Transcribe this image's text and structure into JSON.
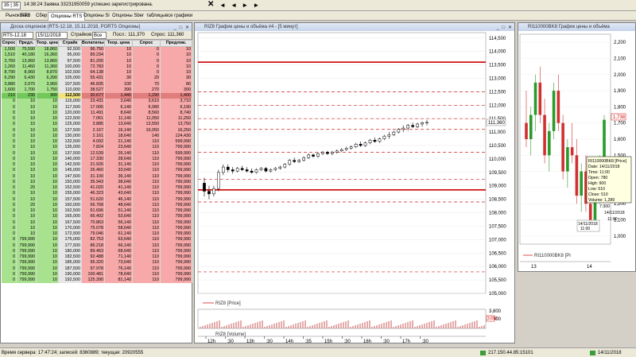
{
  "topbar": {
    "counter": "35 | 35",
    "message": "14:38:24  Заявка 33231950059 успешно зарегистрирована.",
    "nav": "◄ ◄ ► ►"
  },
  "tabs": [
    "Рынок RTS",
    "Бакс",
    "Сбер",
    "Опционы RTS",
    "Опционы Si",
    "Опционы Sber",
    "таблицы",
    "все графики"
  ],
  "options": {
    "title": "Доска опционов (RTS-12.18, 15.11.2018, PORTS Опционы)",
    "base_asset": "RTS-12.18",
    "expiry": "15/11/2018",
    "strikes_label": "Страйков",
    "strikes_value": "Все",
    "last_label": "Посл.: 111,370",
    "bid_label": "Спрос: 111,360",
    "columns": [
      "Спрос",
      "Предл.",
      "Теор. цена",
      "Страйк",
      "Волатильн.",
      "Теор. цена",
      "Спрос",
      "Предлож."
    ],
    "rows": [
      [
        "1,500",
        "75,590",
        "18,860",
        "92,500",
        "96.750",
        "10",
        "0",
        "10"
      ],
      [
        "1,510",
        "40,180",
        "16,360",
        "95,000",
        "89.234",
        "10",
        "0",
        "10"
      ],
      [
        "3,760",
        "13,960",
        "13,860",
        "97,500",
        "81.200",
        "10",
        "0",
        "10"
      ],
      [
        "1,260",
        "11,460",
        "11,360",
        "100,000",
        "72.783",
        "10",
        "0",
        "10"
      ],
      [
        "8,790",
        "8,960",
        "8,870",
        "102,500",
        "64.138",
        "10",
        "0",
        "10"
      ],
      [
        "6,290",
        "6,430",
        "6,390",
        "105,000",
        "55.431",
        "30",
        "20",
        "30"
      ],
      [
        "3,880",
        "3,970",
        "3,960",
        "107,500",
        "46.835",
        "100",
        "70",
        "80"
      ],
      [
        "1,600",
        "1,700",
        "1,750",
        "110,000",
        "38.527",
        "390",
        "270",
        "300"
      ],
      [
        "210",
        "230",
        "300",
        "112,500",
        "30.677",
        "1,440",
        "1,290",
        "1,400"
      ],
      [
        "0",
        "10",
        "10",
        "115,000",
        "23.431",
        "3,640",
        "3,610",
        "3,710"
      ],
      [
        "0",
        "10",
        "10",
        "117,500",
        "17.005",
        "6,140",
        "6,080",
        "6,190"
      ],
      [
        "0",
        "10",
        "10",
        "120,000",
        "11.491",
        "8,640",
        "8,560",
        "8,740"
      ],
      [
        "0",
        "10",
        "10",
        "122,500",
        "7.061",
        "11,140",
        "11,050",
        "11,250"
      ],
      [
        "0",
        "10",
        "10",
        "125,000",
        "3.885",
        "13,640",
        "13,550",
        "13,750"
      ],
      [
        "0",
        "10",
        "10",
        "127,500",
        "2.167",
        "16,140",
        "16,050",
        "16,250"
      ],
      [
        "0",
        "10",
        "10",
        "130,000",
        "2.161",
        "18,640",
        "140",
        "124,430"
      ],
      [
        "0",
        "10",
        "10",
        "132,500",
        "4.092",
        "21,140",
        "110",
        "599,990"
      ],
      [
        "0",
        "10",
        "10",
        "135,000",
        "7.824",
        "23,640",
        "110",
        "799,990"
      ],
      [
        "0",
        "10",
        "10",
        "137,500",
        "12.539",
        "26,140",
        "110",
        "599,990"
      ],
      [
        "0",
        "10",
        "10",
        "140,000",
        "17.330",
        "28,640",
        "110",
        "799,990"
      ],
      [
        "0",
        "10",
        "10",
        "142,500",
        "21.926",
        "31,140",
        "110",
        "799,990"
      ],
      [
        "0",
        "10",
        "10",
        "145,000",
        "26.460",
        "33,640",
        "110",
        "799,990"
      ],
      [
        "0",
        "10",
        "10",
        "147,500",
        "31.100",
        "36,140",
        "110",
        "799,990"
      ],
      [
        "0",
        "10",
        "10",
        "150,000",
        "35.943",
        "38,640",
        "110",
        "799,990"
      ],
      [
        "0",
        "20",
        "10",
        "152,500",
        "41.020",
        "41,140",
        "110",
        "799,990"
      ],
      [
        "0",
        "10",
        "10",
        "155,000",
        "46.323",
        "43,640",
        "110",
        "799,990"
      ],
      [
        "0",
        "10",
        "10",
        "157,500",
        "51.620",
        "46,140",
        "110",
        "799,990"
      ],
      [
        "0",
        "20",
        "10",
        "160,000",
        "56.768",
        "48,640",
        "110",
        "799,990"
      ],
      [
        "0",
        "10",
        "10",
        "162,500",
        "61.696",
        "51,140",
        "110",
        "799,990"
      ],
      [
        "0",
        "10",
        "10",
        "165,000",
        "66.402",
        "53,640",
        "110",
        "799,990"
      ],
      [
        "0",
        "10",
        "10",
        "167,500",
        "70.863",
        "56,140",
        "110",
        "799,990"
      ],
      [
        "0",
        "10",
        "10",
        "170,000",
        "75.078",
        "58,640",
        "110",
        "799,990"
      ],
      [
        "0",
        "10",
        "10",
        "172,500",
        "79.046",
        "61,140",
        "110",
        "799,990"
      ],
      [
        "0",
        "799,990",
        "10",
        "175,000",
        "82.753",
        "63,640",
        "110",
        "799,990"
      ],
      [
        "0",
        "799,990",
        "10",
        "177,500",
        "86.218",
        "66,140",
        "110",
        "799,990"
      ],
      [
        "0",
        "799,990",
        "10",
        "180,000",
        "89.463",
        "68,640",
        "110",
        "799,990"
      ],
      [
        "0",
        "799,990",
        "10",
        "182,500",
        "92.488",
        "71,140",
        "110",
        "799,990"
      ],
      [
        "0",
        "799,990",
        "10",
        "185,000",
        "95.320",
        "73,640",
        "110",
        "799,990"
      ],
      [
        "0",
        "799,990",
        "10",
        "187,500",
        "97.978",
        "76,140",
        "110",
        "799,990"
      ],
      [
        "0",
        "799,990",
        "10",
        "190,000",
        "100.481",
        "78,640",
        "110",
        "799,990"
      ],
      [
        "0",
        "799,990",
        "10",
        "192,500",
        "125.390",
        "81,140",
        "110",
        "799,990"
      ]
    ],
    "highlight_index": 8
  },
  "chart": {
    "title": "RIZ8 График цены и объёма #4 - [5 минут]",
    "price_label": "RIZ8 [Price]",
    "volume_label": "RIZ8 [Volume]",
    "last_price": "111,360",
    "volume_last": "3,652",
    "price_ticks": [
      "114,500",
      "114,000",
      "113,500",
      "113,000",
      "112,500",
      "112,000",
      "111,500",
      "111,000",
      "110,500",
      "110,000",
      "109,500",
      "109,000",
      "108,500",
      "108,000",
      "107,500",
      "107,000",
      "106,500",
      "106,000",
      "105,500",
      "105,000"
    ],
    "time_ticks": [
      "12h",
      ":30",
      "13h",
      ":30",
      "14h",
      ":35",
      "15h",
      ":30",
      "16h",
      ":30",
      "17h",
      ":30"
    ],
    "volume_ticks": [
      "3,800",
      "1,900"
    ]
  },
  "chart_data": {
    "type": "candlestick",
    "ylim": [
      105000,
      114700
    ],
    "candles": [
      [
        109100,
        109300,
        108600,
        108800
      ],
      [
        108800,
        109000,
        108500,
        108700
      ],
      [
        108700,
        109000,
        108600,
        108900
      ],
      [
        108900,
        109600,
        108800,
        109500
      ],
      [
        109500,
        109800,
        109400,
        109700
      ],
      [
        109700,
        109800,
        109500,
        109600
      ],
      [
        109600,
        109700,
        109450,
        109550
      ],
      [
        109550,
        109700,
        109500,
        109650
      ],
      [
        109650,
        109750,
        109550,
        109600
      ],
      [
        109600,
        109700,
        109500,
        109550
      ],
      [
        109550,
        109650,
        109450,
        109500
      ],
      [
        109500,
        109650,
        109450,
        109600
      ],
      [
        109600,
        109700,
        109550,
        109650
      ],
      [
        109650,
        109700,
        109500,
        109550
      ],
      [
        109550,
        109650,
        109500,
        109600
      ],
      [
        109600,
        109700,
        109550,
        109650
      ],
      [
        109650,
        109750,
        109600,
        109700
      ],
      [
        109700,
        109850,
        109650,
        109800
      ],
      [
        109800,
        110000,
        109750,
        109950
      ],
      [
        109950,
        110050,
        109850,
        109900
      ],
      [
        109900,
        110000,
        109850,
        109950
      ],
      [
        109950,
        110100,
        109900,
        110050
      ],
      [
        110050,
        110200,
        110000,
        110150
      ],
      [
        110150,
        110200,
        110050,
        110100
      ],
      [
        110100,
        110250,
        110050,
        110200
      ],
      [
        110200,
        110300,
        110150,
        110250
      ],
      [
        110250,
        110300,
        110150,
        110200
      ],
      [
        110200,
        110300,
        110150,
        110250
      ],
      [
        110250,
        110350,
        110200,
        110300
      ],
      [
        110300,
        110400,
        110250,
        110350
      ],
      [
        110350,
        110450,
        110300,
        110400
      ],
      [
        110400,
        110500,
        110350,
        110450
      ],
      [
        110450,
        110600,
        110400,
        110550
      ],
      [
        110550,
        110650,
        110450,
        110500
      ],
      [
        110500,
        110650,
        110450,
        110600
      ],
      [
        110600,
        110750,
        110550,
        110700
      ],
      [
        110700,
        110800,
        110600,
        110650
      ],
      [
        110650,
        110800,
        110600,
        110750
      ],
      [
        110750,
        110900,
        110700,
        110850
      ],
      [
        110850,
        111000,
        110750,
        110900
      ],
      [
        110900,
        111050,
        110850,
        111000
      ],
      [
        111000,
        111150,
        110950,
        111100
      ],
      [
        111100,
        111250,
        111000,
        111150
      ],
      [
        111150,
        111300,
        111050,
        111250
      ],
      [
        111250,
        111350,
        111150,
        111200
      ],
      [
        111200,
        111350,
        111150,
        111300
      ],
      [
        111300,
        111400,
        111200,
        111350
      ],
      [
        111350,
        111450,
        111250,
        111360
      ]
    ],
    "levels_solid": [
      113600,
      108850
    ],
    "levels_dashed": [
      112500,
      112000,
      111500,
      111100,
      110250,
      109250,
      108400,
      105800
    ]
  },
  "small_chart": {
    "title": "RI110000BK8 График цены и объёма",
    "label": "RI110000BK8 [Pr",
    "last": "1,738",
    "ticks": [
      "2,200",
      "2,100",
      "2,000",
      "1,900",
      "1,800",
      "1,700",
      "1,600",
      "1,500",
      "1,400",
      "1,300",
      "1,200",
      "1,100",
      "1,000"
    ],
    "time_ticks": [
      "13",
      "14"
    ],
    "tooltip": [
      "RI110000BK8 [Price]",
      "Date: 14/11/2018",
      "Time: 11:00",
      "Open: 780",
      "High: 900",
      "Low: 510",
      "Close: 510",
      "Volume: 1,289"
    ],
    "low_label1": "14/11/2018",
    "low_label2": "11:00",
    "low_label3": "7:300",
    "hover_date": "14/11/2018",
    "hover_time": "11:00"
  },
  "status": {
    "left": "Время сервера: 17:47:24; записей: 8360889; текущая: 20920555",
    "ip": "217.150.44.85:15101",
    "date": "14/11/2018"
  }
}
